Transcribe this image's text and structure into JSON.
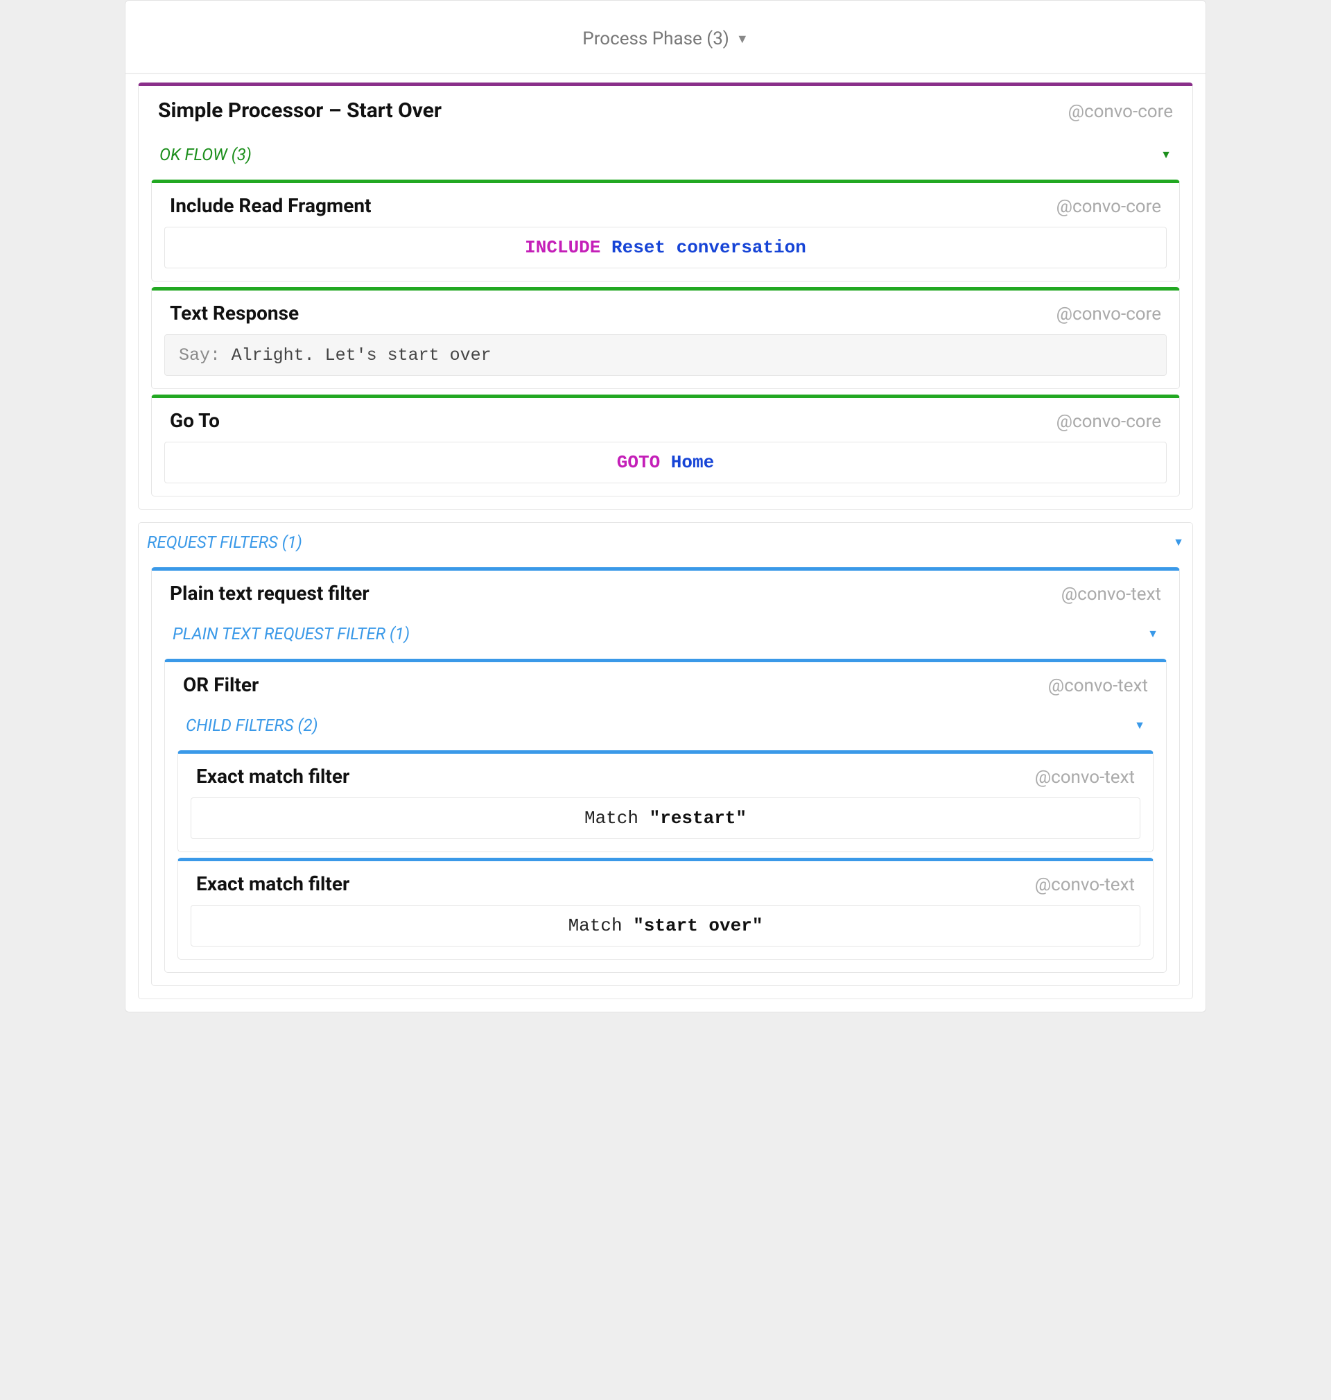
{
  "phase": {
    "label": "Process Phase (3)"
  },
  "processor": {
    "title": "Simple Processor – Start Over",
    "provider": "@convo-core",
    "okflow": {
      "label": "OK FLOW (3)",
      "items": {
        "include": {
          "title": "Include Read Fragment",
          "provider": "@convo-core",
          "keyword": "INCLUDE",
          "target": "Reset conversation"
        },
        "text": {
          "title": "Text Response",
          "provider": "@convo-core",
          "prefix": "Say:",
          "value": "Alright. Let's start over"
        },
        "goto": {
          "title": "Go To",
          "provider": "@convo-core",
          "keyword": "GOTO",
          "target": "Home"
        }
      }
    }
  },
  "requestFilters": {
    "label": "REQUEST FILTERS (1)",
    "plain": {
      "title": "Plain text request filter",
      "provider": "@convo-text",
      "innerLabel": "PLAIN TEXT REQUEST FILTER (1)",
      "or": {
        "title": "OR Filter",
        "provider": "@convo-text",
        "childLabel": "CHILD FILTERS (2)",
        "children": [
          {
            "title": "Exact match filter",
            "provider": "@convo-text",
            "keyword": "Match",
            "value": "\"restart\""
          },
          {
            "title": "Exact match filter",
            "provider": "@convo-text",
            "keyword": "Match",
            "value": "\"start over\""
          }
        ]
      }
    }
  }
}
